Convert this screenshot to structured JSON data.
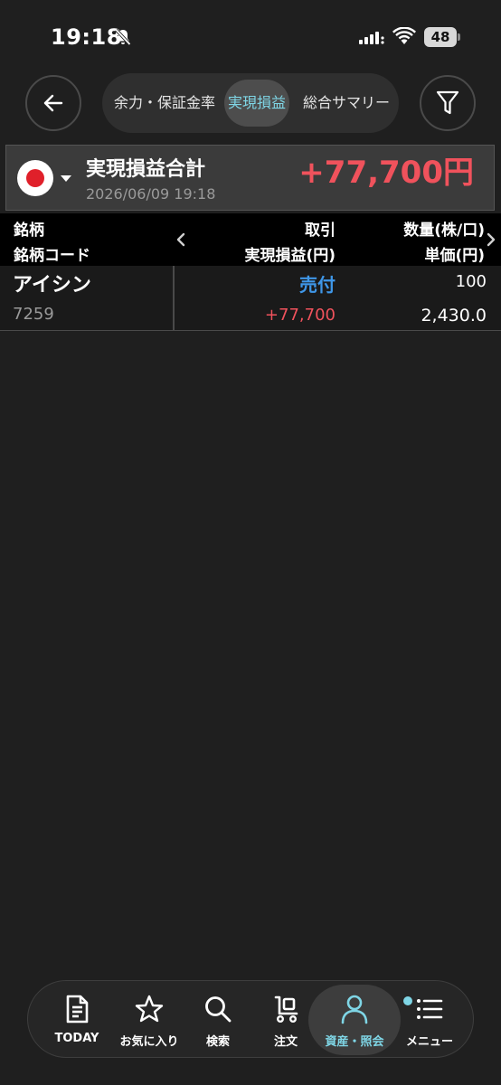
{
  "status_bar": {
    "time": "19:18",
    "battery": "48",
    "icons": [
      "bell-off-icon",
      "cellular-signal-icon",
      "wifi-icon",
      "battery-icon"
    ]
  },
  "header": {
    "tabs": [
      {
        "label": "余力・保証金率",
        "active": false
      },
      {
        "label": "実現損益",
        "active": true
      },
      {
        "label": "総合サマリー",
        "active": false
      }
    ],
    "icons": [
      "back-arrow-icon",
      "filter-icon"
    ]
  },
  "summary": {
    "market_icon": "japan-flag-icon",
    "title": "実現損益合計",
    "datetime": "2026/06/09 19:18",
    "total": "+77,700円"
  },
  "table": {
    "headers": {
      "name": "銘柄",
      "code": "銘柄コード",
      "trade": "取引",
      "realized_pl": "実現損益(円)",
      "quantity": "数量(株/口)",
      "unit_price": "単価(円)"
    },
    "rows": [
      {
        "name": "アイシン",
        "code": "7259",
        "trade": "売付",
        "realized_pl": "+77,700",
        "quantity": "100",
        "unit_price": "2,430.0"
      }
    ]
  },
  "bottom_nav": {
    "items": [
      {
        "label": "TODAY",
        "icon": "document-icon",
        "active": false
      },
      {
        "label": "お気に入り",
        "icon": "star-icon",
        "active": false
      },
      {
        "label": "検索",
        "icon": "search-icon",
        "active": false
      },
      {
        "label": "注文",
        "icon": "cart-icon",
        "active": false
      },
      {
        "label": "資産・照会",
        "icon": "person-icon",
        "active": true
      },
      {
        "label": "メニュー",
        "icon": "menu-icon",
        "active": false
      }
    ]
  },
  "colors": {
    "background": "#1f1f1f",
    "accent": "#7fd6e6",
    "profit": "#f0525c",
    "sell": "#3f97e8"
  }
}
